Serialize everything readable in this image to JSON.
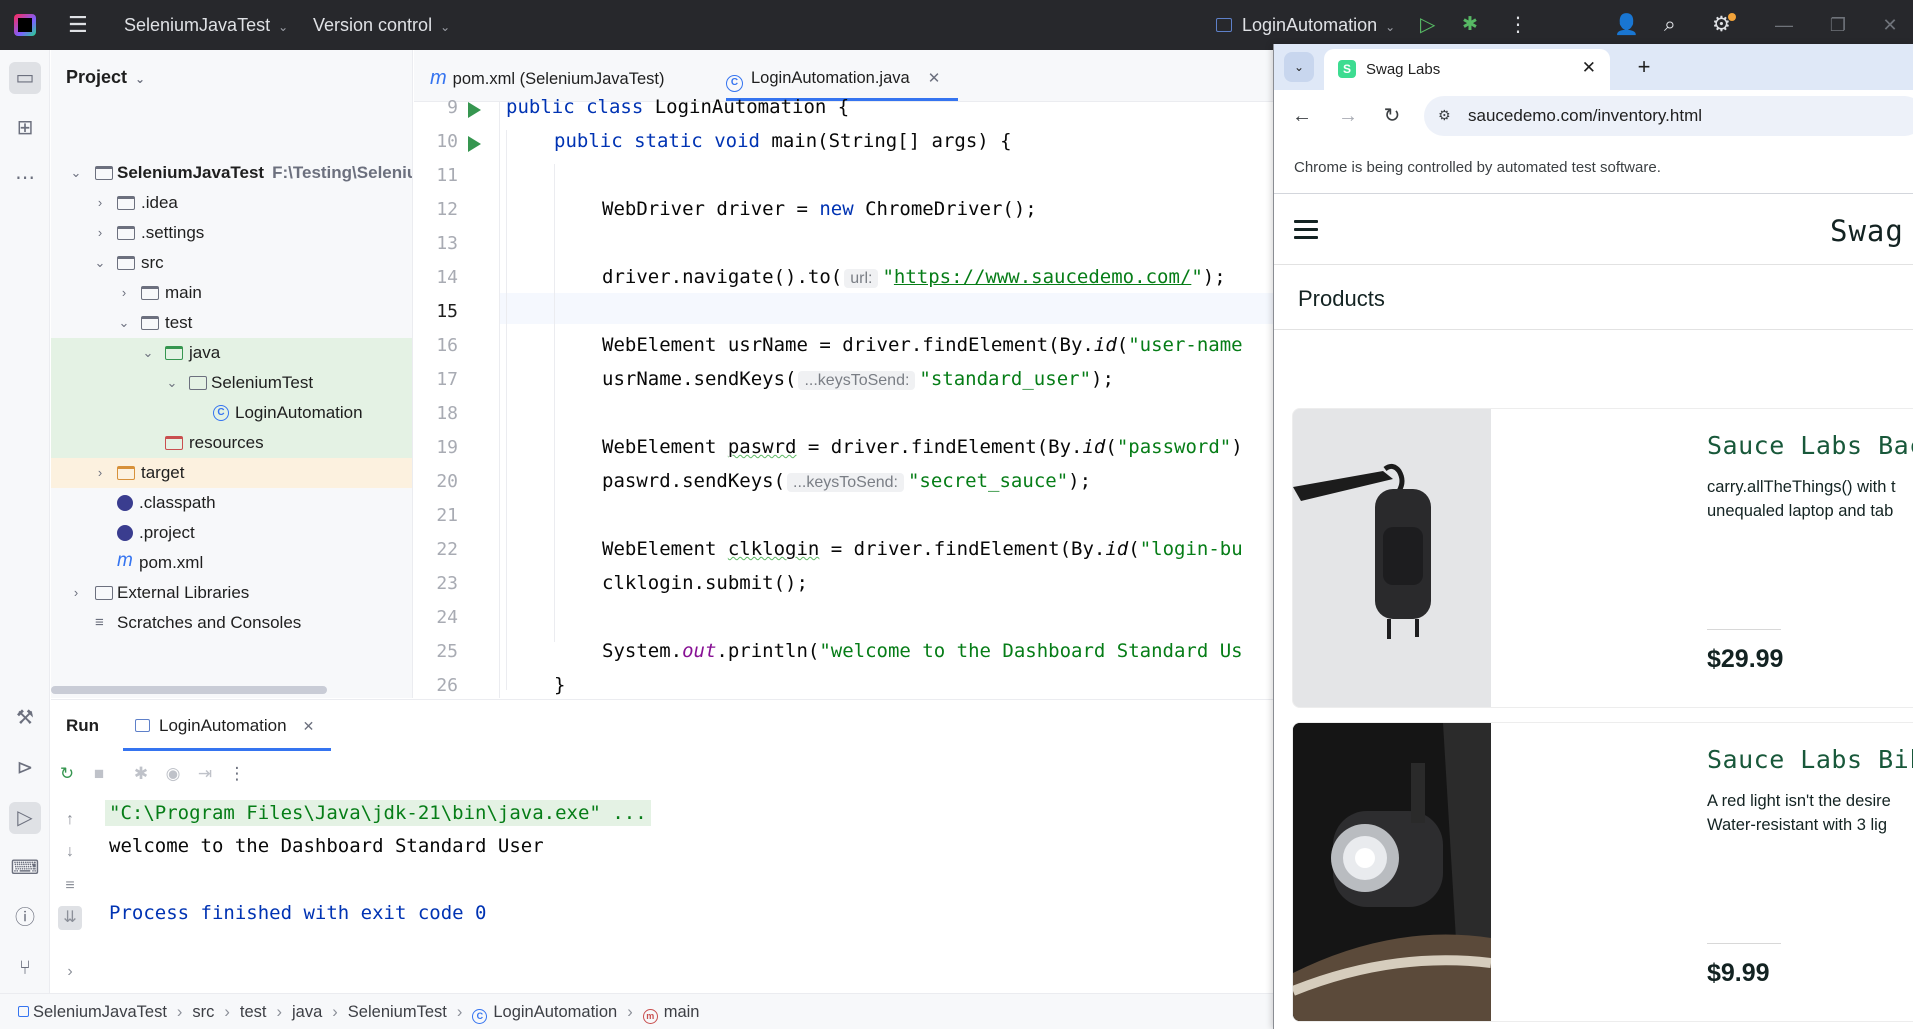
{
  "titlebar": {
    "project_name": "SeleniumJavaTest",
    "vcs": "Version control",
    "run_config": "LoginAutomation"
  },
  "project_panel": {
    "title": "Project",
    "tree": [
      {
        "label": "SeleniumJavaTest",
        "path": "F:\\Testing\\Selenium"
      },
      {
        "label": ".idea"
      },
      {
        "label": ".settings"
      },
      {
        "label": "src"
      },
      {
        "label": "main"
      },
      {
        "label": "test"
      },
      {
        "label": "java"
      },
      {
        "label": "SeleniumTest"
      },
      {
        "label": "LoginAutomation"
      },
      {
        "label": "resources"
      },
      {
        "label": "target"
      },
      {
        "label": ".classpath"
      },
      {
        "label": ".project"
      },
      {
        "label": "pom.xml"
      },
      {
        "label": "External Libraries"
      },
      {
        "label": "Scratches and Consoles"
      }
    ]
  },
  "editor": {
    "tabs": [
      {
        "label": "pom.xml (SeleniumJavaTest)"
      },
      {
        "label": "LoginAutomation.java"
      }
    ],
    "line_numbers": [
      "9",
      "10",
      "11",
      "12",
      "13",
      "14",
      "15",
      "16",
      "17",
      "18",
      "19",
      "20",
      "21",
      "22",
      "23",
      "24",
      "25",
      "26"
    ],
    "code": {
      "l9_kw1": "public",
      "l9_kw2": "class",
      "l9_rest": " LoginAutomation {",
      "l10_kw1": "public",
      "l10_kw2": "static",
      "l10_kw3": "void",
      "l10_rest": " main(String[] args) {",
      "l12_a": "WebDriver driver = ",
      "l12_kw": "new",
      "l12_b": " ChromeDriver();",
      "l14_a": "driver.navigate().to(",
      "l14_hint": "url:",
      "l14_q1": "\"",
      "l14_url": "https://www.saucedemo.com/",
      "l14_q2": "\"",
      "l14_b": ");",
      "l16_a": "WebElement usrName = driver.findElement(By.",
      "l16_id": "id",
      "l16_b": "(",
      "l16_str": "\"user-name",
      "l17_a": "usrName.sendKeys(",
      "l17_hint": "...keysToSend:",
      "l17_str": "\"standard_user\"",
      "l17_b": ");",
      "l19_a": "WebElement ",
      "l19_var": "paswrd",
      "l19_b": " = driver.findElement(By.",
      "l19_id": "id",
      "l19_c": "(",
      "l19_str": "\"password\"",
      "l19_d": ")",
      "l20_a": "paswrd.sendKeys(",
      "l20_hint": "...keysToSend:",
      "l20_str": "\"secret_sauce\"",
      "l20_b": ");",
      "l22_a": "WebElement ",
      "l22_var": "clklogin",
      "l22_b": " = driver.findElement(By.",
      "l22_id": "id",
      "l22_c": "(",
      "l22_str": "\"login-bu",
      "l23": "clklogin.submit();",
      "l25_a": "System.",
      "l25_out": "out",
      "l25_b": ".println(",
      "l25_str": "\"welcome to the Dashboard Standard Us",
      "l26": "}"
    }
  },
  "run_panel": {
    "title": "Run",
    "tab": "LoginAutomation",
    "console": [
      "\"C:\\Program Files\\Java\\jdk-21\\bin\\java.exe\" ...",
      "welcome to the Dashboard Standard User",
      "",
      "Process finished with exit code 0"
    ]
  },
  "statusbar": {
    "breadcrumbs": [
      "SeleniumJavaTest",
      "src",
      "test",
      "java",
      "SeleniumTest",
      "LoginAutomation",
      "main"
    ]
  },
  "browser": {
    "tab_title": "Swag Labs",
    "url": "saucedemo.com/inventory.html",
    "infobar": "Chrome is being controlled by automated test software.",
    "logo": "Swag",
    "section_title": "Products",
    "products": [
      {
        "name": "Sauce Labs Bac",
        "desc_line1": "carry.allTheThings() with t",
        "desc_line2": "unequaled laptop and tab",
        "price": "$29.99"
      },
      {
        "name": "Sauce Labs Bik",
        "desc_line1": "A red light isn't the desire",
        "desc_line2": "Water-resistant with 3 lig",
        "price": "$9.99"
      }
    ]
  },
  "colors": {
    "ide_titlebar": "#27282c",
    "accent": "#3574f0",
    "run_green": "#369650",
    "string_green": "#067d17",
    "keyword_blue": "#0033b3",
    "saucedemo_green": "#18583a"
  }
}
